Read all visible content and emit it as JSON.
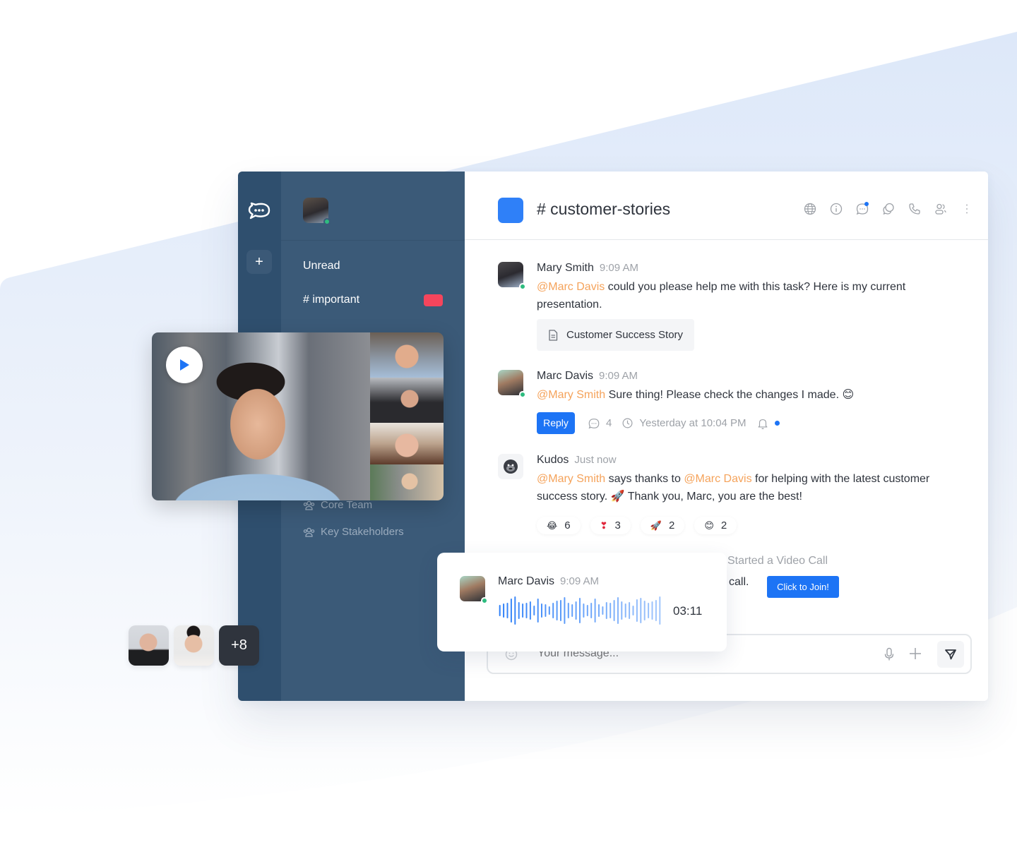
{
  "app": {
    "brand_color": "#1d74f5",
    "sidebar_color": "#3b5a78",
    "rail_color": "#2f4f6e",
    "mention_color": "#f5a35b",
    "online_color": "#2ebc7f",
    "icons": {
      "logo": "chat-bubble-logo-icon",
      "new": "plus-icon"
    }
  },
  "sidebar": {
    "current_user": {
      "status": "online"
    },
    "items": [
      {
        "label": "Unread"
      },
      {
        "label": "# important",
        "badge_color": "#f5455c"
      }
    ],
    "teams": [
      {
        "label": "Core Team",
        "icon": "team-icon"
      },
      {
        "label": "Key Stakeholders",
        "icon": "team-icon"
      }
    ]
  },
  "room": {
    "title": "# customer-stories",
    "avatar_color": "#2f80f8",
    "header_icons": [
      "globe-icon",
      "info-icon",
      "discussion-icon",
      "threads-icon",
      "phone-icon",
      "members-icon",
      "kebab-menu-icon"
    ]
  },
  "messages": [
    {
      "author": "Mary Smith",
      "time": "9:09 AM",
      "mention": "@Marc Davis",
      "text": " could you please help me with this task? Here is my current presentation.",
      "attachment": "Customer Success Story"
    },
    {
      "author": "Marc Davis",
      "time": "9:09 AM",
      "mention": "@Mary Smith",
      "text": " Sure thing! Please check the changes I made. 😊",
      "reply_label": "Reply",
      "thread_count": "4",
      "thread_last": "Yesterday at 10:04 PM"
    },
    {
      "author": "Kudos",
      "time": "Just now",
      "mention1": "@Mary Smith",
      "text1": " says thanks to ",
      "mention2": "@Marc Davis",
      "text2": " for helping with the latest customer success story. 🚀 Thank you, Marc, you are the best!",
      "reactions": [
        {
          "emoji": "😂",
          "count": "6"
        },
        {
          "emoji": "❣",
          "count": "3"
        },
        {
          "emoji": "🚀",
          "count": "2"
        },
        {
          "emoji": "😊",
          "count": "2"
        }
      ]
    }
  ],
  "video_call": {
    "system_text": "Started a Video Call",
    "text": "call.",
    "join_label": "Click to Join!"
  },
  "composer": {
    "placeholder": "Your message..."
  },
  "voice_message": {
    "author": "Marc Davis",
    "time": "9:09 AM",
    "duration": "03:11"
  },
  "avatar_group": {
    "more_label": "+8"
  },
  "video_card": {
    "play_label": "play"
  }
}
